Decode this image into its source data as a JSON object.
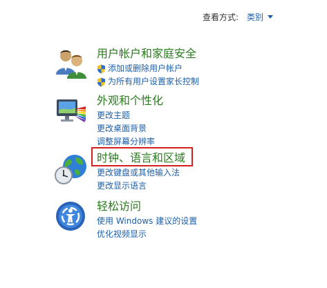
{
  "view_by": {
    "label": "查看方式:",
    "value": "类别"
  },
  "categories": [
    {
      "title": "用户帐户和家庭安全",
      "icon": "users-icon",
      "links": [
        {
          "text": "添加或删除用户帐户",
          "shield": true
        },
        {
          "text": "为所有用户设置家长控制",
          "shield": true
        }
      ]
    },
    {
      "title": "外观和个性化",
      "icon": "appearance-monitor-icon",
      "links": [
        {
          "text": "更改主题"
        },
        {
          "text": "更改桌面背景"
        },
        {
          "text": "调整屏幕分辨率"
        }
      ]
    },
    {
      "title": "时钟、语言和区域",
      "icon": "clock-globe-icon",
      "links": [
        {
          "text": "更改键盘或其他输入法"
        },
        {
          "text": "更改显示语言"
        }
      ]
    },
    {
      "title": "轻松访问",
      "icon": "ease-of-access-icon",
      "links": [
        {
          "text": "使用 Windows 建议的设置"
        },
        {
          "text": "优化视频显示"
        }
      ]
    }
  ],
  "colors": {
    "category_title": "#2a7a1e",
    "link": "#1e5fa8",
    "highlight_border": "#d41f1f"
  }
}
